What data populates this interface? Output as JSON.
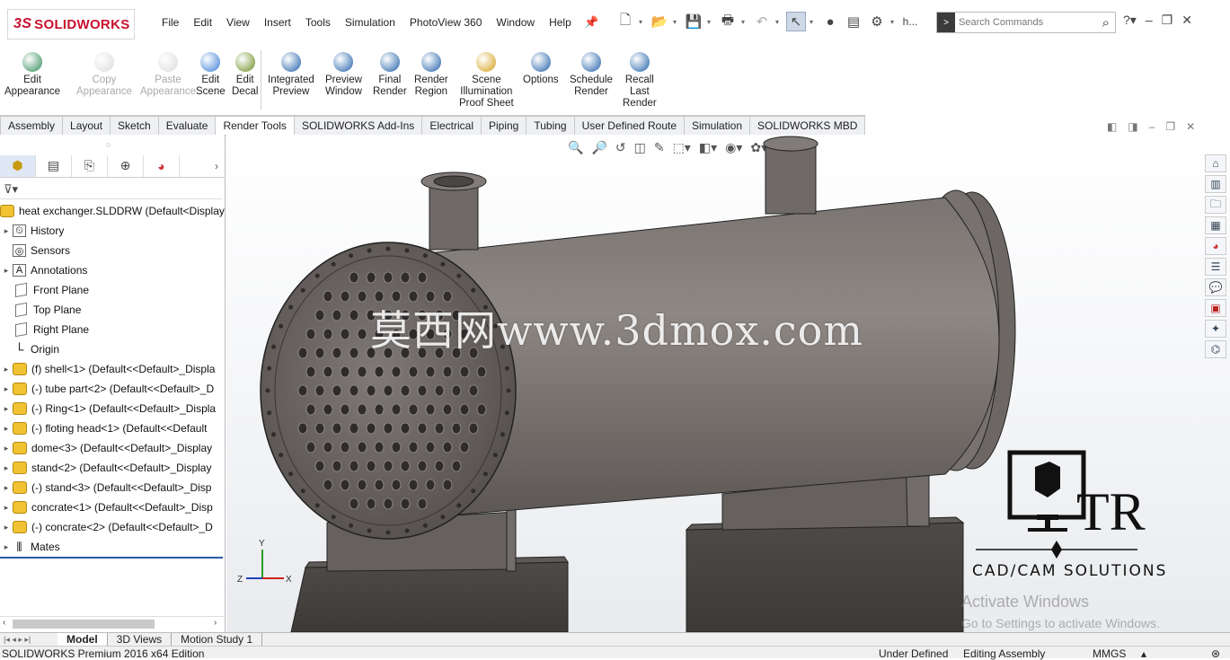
{
  "app": {
    "brand": "SOLIDWORKS",
    "brand_prefix": "3S"
  },
  "menu": [
    "File",
    "Edit",
    "View",
    "Insert",
    "Tools",
    "Simulation",
    "PhotoView 360",
    "Window",
    "Help"
  ],
  "quick_access": {
    "user_initial": "h..."
  },
  "search": {
    "placeholder": "Search Commands"
  },
  "ribbon": [
    {
      "label": "Edit\nAppearance",
      "enabled": true,
      "color": "#2e8b57"
    },
    {
      "label": "Copy\nAppearance",
      "enabled": false,
      "color": "#999999"
    },
    {
      "label": "Paste\nAppearance",
      "enabled": false,
      "color": "#999999"
    },
    {
      "label": "Edit\nScene",
      "enabled": true,
      "color": "#3a7bd5"
    },
    {
      "label": "Edit\nDecal",
      "enabled": true,
      "color": "#6b8e23"
    },
    {
      "label": "Integrated\nPreview",
      "enabled": true,
      "color": "#1f5fa8"
    },
    {
      "label": "Preview\nWindow",
      "enabled": true,
      "color": "#1f5fa8"
    },
    {
      "label": "Final\nRender",
      "enabled": true,
      "color": "#1f5fa8"
    },
    {
      "label": "Render\nRegion",
      "enabled": true,
      "color": "#1f5fa8"
    },
    {
      "label": "Scene\nIllumination\nProof Sheet",
      "enabled": true,
      "color": "#d4a017"
    },
    {
      "label": "Options",
      "enabled": true,
      "color": "#1f5fa8"
    },
    {
      "label": "Schedule\nRender",
      "enabled": true,
      "color": "#1f5fa8"
    },
    {
      "label": "Recall\nLast\nRender",
      "enabled": true,
      "color": "#1f5fa8"
    }
  ],
  "tabs": [
    "Assembly",
    "Layout",
    "Sketch",
    "Evaluate",
    "Render Tools",
    "SOLIDWORKS Add-Ins",
    "Electrical",
    "Piping",
    "Tubing",
    "User Defined Route",
    "Simulation",
    "SOLIDWORKS MBD"
  ],
  "active_tab": "Render Tools",
  "tree": {
    "root": "heat exchanger.SLDDRW  (Default<Display",
    "items": [
      {
        "label": "History",
        "icon": "history-icon",
        "expandable": true
      },
      {
        "label": "Sensors",
        "icon": "sensors-icon",
        "expandable": false
      },
      {
        "label": "Annotations",
        "icon": "annotations-icon",
        "expandable": true
      },
      {
        "label": "Front Plane",
        "icon": "plane-icon",
        "expandable": false
      },
      {
        "label": "Top Plane",
        "icon": "plane-icon",
        "expandable": false
      },
      {
        "label": "Right Plane",
        "icon": "plane-icon",
        "expandable": false
      },
      {
        "label": "Origin",
        "icon": "origin-icon",
        "expandable": false
      },
      {
        "label": "(f) shell<1> (Default<<Default>_Displa",
        "icon": "part-icon",
        "expandable": true
      },
      {
        "label": "(-) tube part<2> (Default<<Default>_D",
        "icon": "part-icon",
        "expandable": true
      },
      {
        "label": "(-) Ring<1> (Default<<Default>_Displa",
        "icon": "part-icon",
        "expandable": true
      },
      {
        "label": "(-) floting head<1> (Default<<Default",
        "icon": "part-icon",
        "expandable": true
      },
      {
        "label": "dome<3> (Default<<Default>_Display",
        "icon": "part-icon",
        "expandable": true
      },
      {
        "label": "stand<2> (Default<<Default>_Display",
        "icon": "part-icon",
        "expandable": true
      },
      {
        "label": "(-) stand<3> (Default<<Default>_Disp",
        "icon": "part-icon",
        "expandable": true
      },
      {
        "label": "concrate<1> (Default<<Default>_Disp",
        "icon": "part-icon",
        "expandable": true
      },
      {
        "label": "(-) concrate<2> (Default<<Default>_D",
        "icon": "part-icon",
        "expandable": true
      },
      {
        "label": "Mates",
        "icon": "mates-icon",
        "expandable": true
      }
    ]
  },
  "viewport": {
    "watermark": "莫西网www.3dmox.com",
    "triad": {
      "x": "X",
      "y": "Y",
      "z": "Z"
    },
    "brand_caption": "CAD/CAM SOLUTIONS",
    "brand_letters": "TR",
    "activation_title": "Activate Windows",
    "activation_sub": "Go to Settings to activate Windows."
  },
  "bottom_tabs": [
    "Model",
    "3D Views",
    "Motion Study 1"
  ],
  "active_bottom_tab": "Model",
  "status": {
    "edition": "SOLIDWORKS Premium 2016 x64 Edition",
    "state": "Under Defined",
    "mode": "Editing Assembly",
    "units": "MMGS"
  }
}
